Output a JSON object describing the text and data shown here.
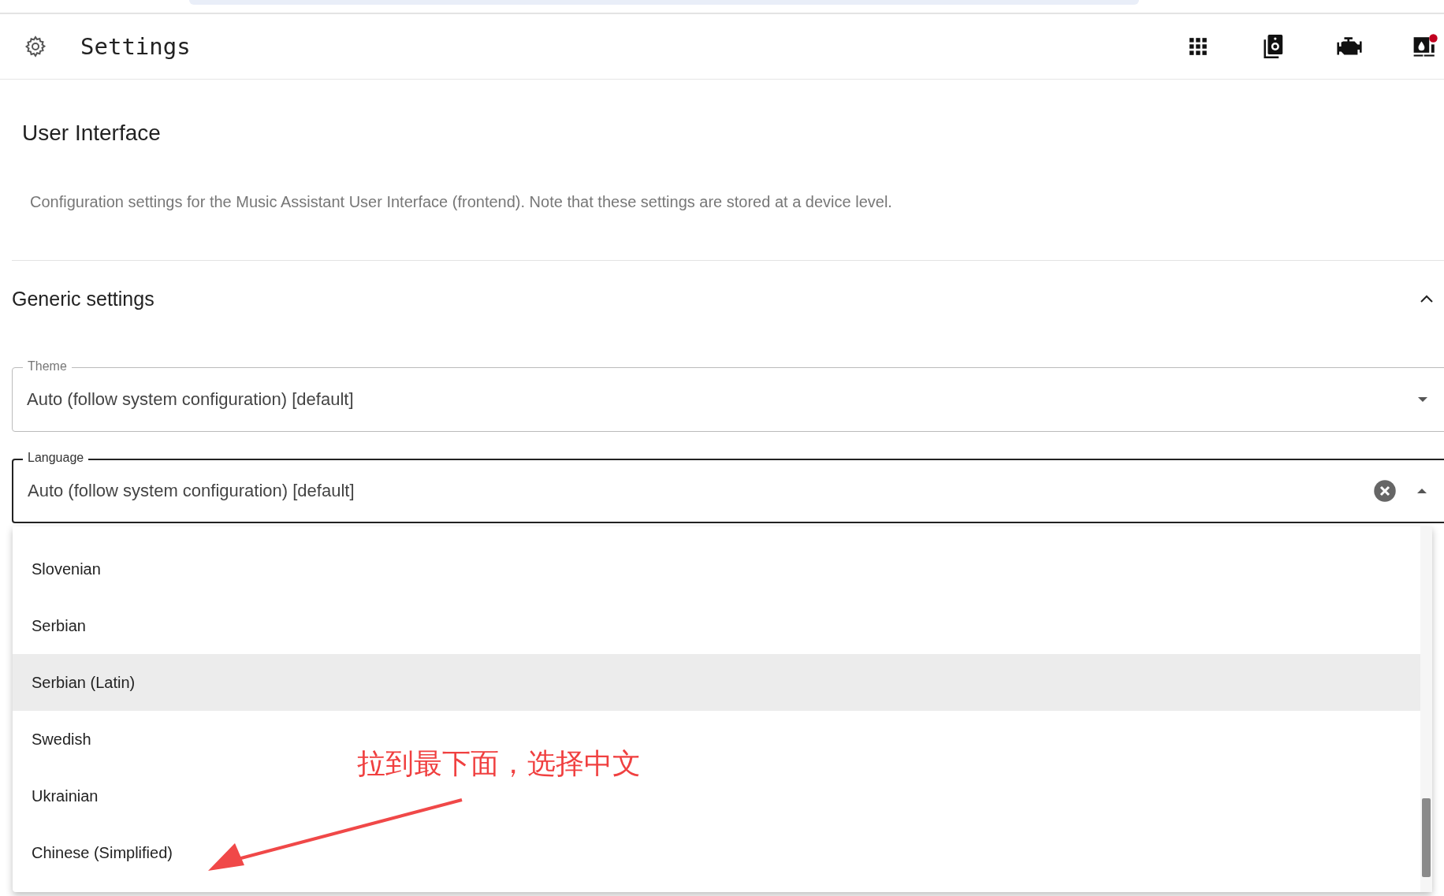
{
  "top_bar": {
    "title": "Settings"
  },
  "page": {
    "heading": "User Interface",
    "description": "Configuration settings for the Music Assistant User Interface (frontend). Note that these settings are stored at a device level."
  },
  "section": {
    "title": "Generic settings",
    "expanded": true
  },
  "fields": [
    {
      "label": "Theme",
      "value": "Auto (follow system configuration) [default]",
      "focused": false,
      "clearable": false
    },
    {
      "label": "Language",
      "value": "Auto (follow system configuration) [default]",
      "focused": true,
      "clearable": true
    }
  ],
  "menu": {
    "items": [
      {
        "label": "Slovenian",
        "highlighted": false
      },
      {
        "label": "Serbian",
        "highlighted": false
      },
      {
        "label": "Serbian (Latin)",
        "highlighted": true
      },
      {
        "label": "Swedish",
        "highlighted": false
      },
      {
        "label": "Ukrainian",
        "highlighted": false
      },
      {
        "label": "Chinese (Simplified)",
        "highlighted": false
      }
    ]
  },
  "annotation": {
    "text": "拉到最下面，选择中文"
  }
}
